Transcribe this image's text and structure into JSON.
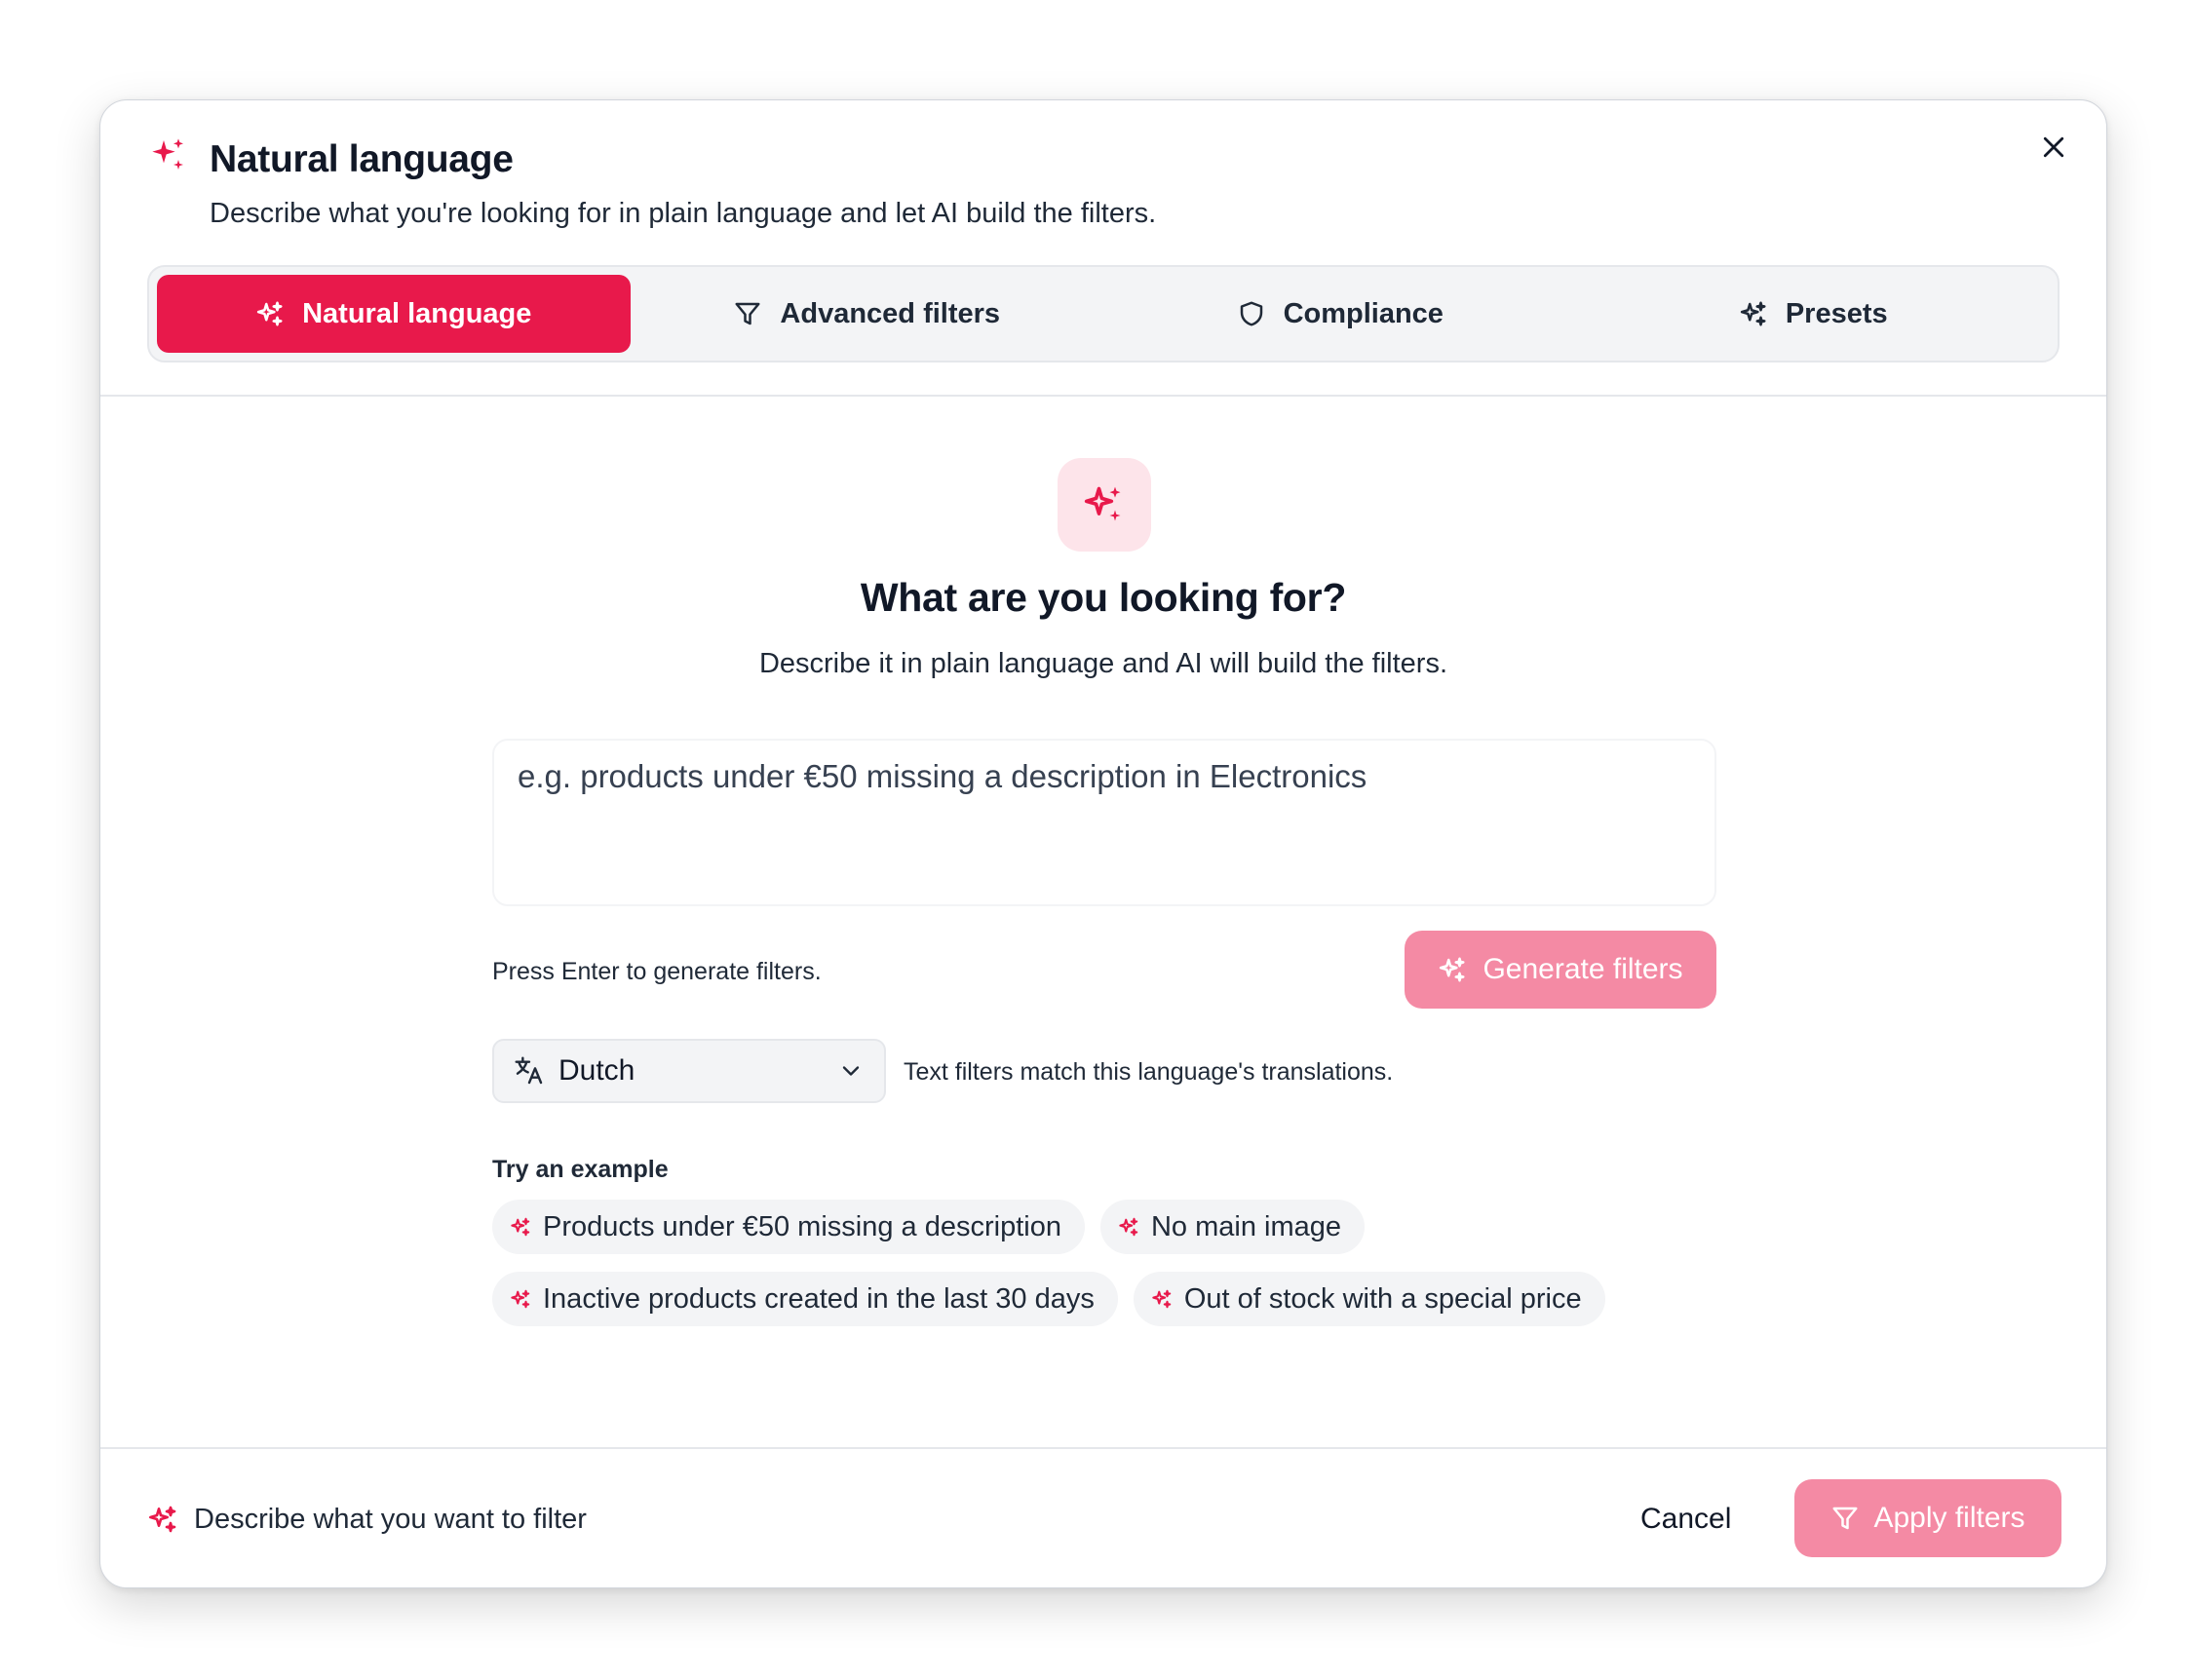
{
  "colors": {
    "accent": "#e8194b",
    "accent_soft": "#fde4ea",
    "accent_disabled": "#f48aa4"
  },
  "header": {
    "icon": "sparkles-icon",
    "title": "Natural language",
    "subtitle": "Describe what you're looking for in plain language and let AI build the filters.",
    "close_icon": "close-icon"
  },
  "tabs": [
    {
      "label": "Natural language",
      "icon": "sparkles-icon",
      "active": true
    },
    {
      "label": "Advanced filters",
      "icon": "filter-icon",
      "active": false
    },
    {
      "label": "Compliance",
      "icon": "shield-icon",
      "active": false
    },
    {
      "label": "Presets",
      "icon": "sparkles-icon",
      "active": false
    }
  ],
  "main": {
    "hero_icon": "sparkles-icon",
    "title": "What are you looking for?",
    "subtitle": "Describe it in plain language and AI will build the filters.",
    "query": {
      "value": "",
      "placeholder": "e.g. products under €50 missing a description in Electronics"
    },
    "hint": "Press Enter to generate filters.",
    "generate_label": "Generate filters",
    "language": {
      "icon": "translate-icon",
      "selected": "Dutch",
      "note": "Text filters match this language's translations."
    },
    "examples_label": "Try an example",
    "examples": [
      "Products under €50 missing a description",
      "No main image",
      "Inactive products created in the last 30 days",
      "Out of stock with a special price"
    ]
  },
  "footer": {
    "icon": "sparkles-icon",
    "text": "Describe what you want to filter",
    "cancel_label": "Cancel",
    "apply_label": "Apply filters"
  }
}
